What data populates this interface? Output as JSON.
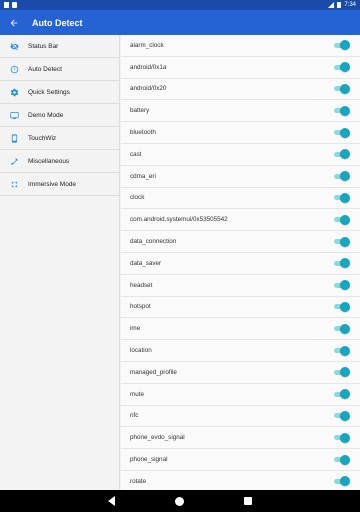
{
  "status_bar": {
    "time": "7:34"
  },
  "app_bar": {
    "title": "Auto Detect"
  },
  "sidebar": {
    "items": [
      {
        "label": "Status Bar",
        "icon": "eye-off-icon"
      },
      {
        "label": "Auto Detect",
        "icon": "help-circle-icon"
      },
      {
        "label": "Quick Settings",
        "icon": "gear-icon"
      },
      {
        "label": "Demo Mode",
        "icon": "monitor-icon"
      },
      {
        "label": "TouchWiz",
        "icon": "phone-icon"
      },
      {
        "label": "Miscellaneous",
        "icon": "wrench-icon"
      },
      {
        "label": "Immersive Mode",
        "icon": "fullscreen-icon"
      }
    ]
  },
  "list": {
    "items": [
      {
        "label": "alarm_clock",
        "enabled": true
      },
      {
        "label": "android/0x1a",
        "enabled": true
      },
      {
        "label": "android/0x20",
        "enabled": true
      },
      {
        "label": "battery",
        "enabled": true
      },
      {
        "label": "bluetooth",
        "enabled": true
      },
      {
        "label": "cast",
        "enabled": true
      },
      {
        "label": "cdma_eri",
        "enabled": true
      },
      {
        "label": "clock",
        "enabled": true
      },
      {
        "label": "com.android.systemui/0x53505542",
        "enabled": true
      },
      {
        "label": "data_connection",
        "enabled": true
      },
      {
        "label": "data_saver",
        "enabled": true
      },
      {
        "label": "headset",
        "enabled": true
      },
      {
        "label": "hotspot",
        "enabled": true
      },
      {
        "label": "ime",
        "enabled": true
      },
      {
        "label": "location",
        "enabled": true
      },
      {
        "label": "managed_profile",
        "enabled": true
      },
      {
        "label": "mute",
        "enabled": true
      },
      {
        "label": "nfc",
        "enabled": true
      },
      {
        "label": "phone_evdo_signal",
        "enabled": true
      },
      {
        "label": "phone_signal",
        "enabled": true
      },
      {
        "label": "rotate",
        "enabled": true
      }
    ]
  },
  "colors": {
    "primary": "#2562d3",
    "status_bar": "#1a4ba8",
    "accent": "#17a6c0",
    "sidebar_icon": "#1c8ddd"
  }
}
